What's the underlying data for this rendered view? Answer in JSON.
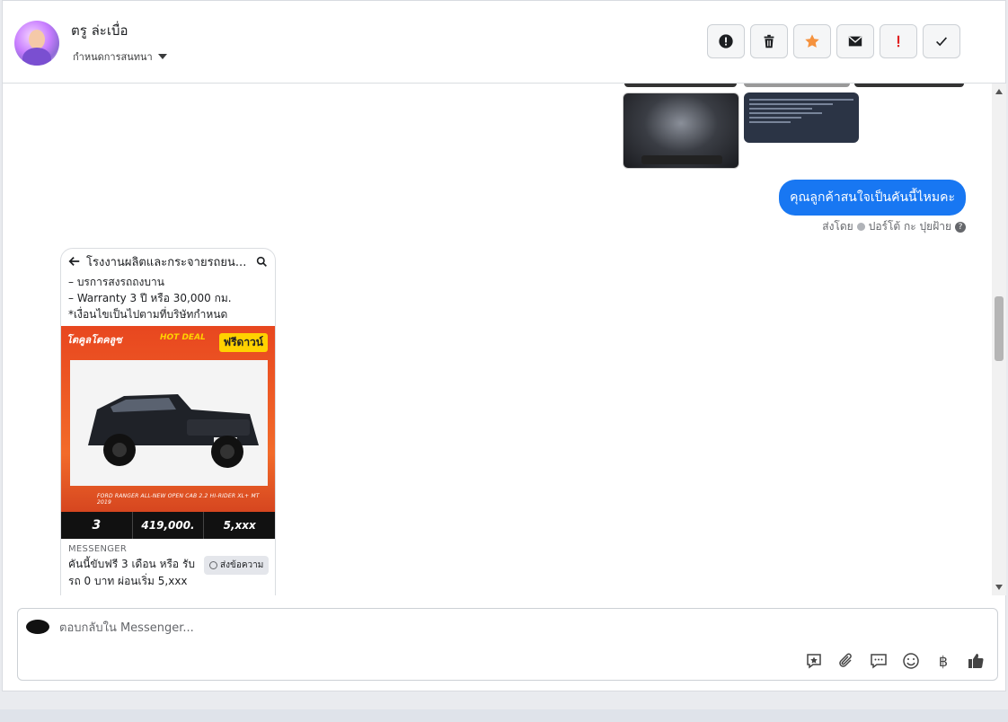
{
  "header": {
    "contact_name": "ตรู ล่ะเบื่อ",
    "assign_label": "กำหนดการสนทนา",
    "actions": [
      {
        "name": "report-button",
        "icon": "alert-circle-icon"
      },
      {
        "name": "delete-button",
        "icon": "trash-icon"
      },
      {
        "name": "star-button",
        "icon": "star-icon"
      },
      {
        "name": "mail-button",
        "icon": "envelope-icon"
      },
      {
        "name": "important-button",
        "icon": "exclamation-icon"
      },
      {
        "name": "done-button",
        "icon": "check-icon"
      }
    ]
  },
  "thread": {
    "outgoing_message": "คุณลูกค้าสนใจเป็นคันนี้ไหมคะ",
    "sent_by_label": "ส่งโดย",
    "sent_by_name": "ปอร์โต้ กะ ปุยฝ้าย",
    "card": {
      "title": "โรงงานผลิตและกระจายรถยน...",
      "lines": [
        "– บรการสงรถถงบาน",
        "– Warranty 3 ปี หรือ 30,000 กม.",
        "*เงื่อนไขเป็นไปตามที่บริษัทกำหนด"
      ],
      "poster": {
        "brand": "โตคูลโตคลูซ",
        "hot_deal": "HOT DEAL",
        "free_down": "ฟรีดาวน์",
        "model_text": "FORD RANGER ALL-NEW OPEN CAB 2.2 HI-RIDER XL+ MT 2019",
        "stat_1": "3",
        "price": "419,000.",
        "installment": "5,xxx"
      },
      "source": "MESSENGER",
      "description": "คันนี้ขับฟรี 3 เดือน หรือ รับรถ 0 บาท ผ่อนเริ่ม 5,xxx ...",
      "send_message_label": "ส่งข้อความ"
    }
  },
  "composer": {
    "placeholder": "ตอบกลับใน Messenger...",
    "value": "",
    "tools": [
      "saved-reply-icon",
      "paperclip-icon",
      "chat-bubbles-icon",
      "emoji-icon",
      "baht-icon",
      "thumbs-up-icon"
    ],
    "baht_symbol": "฿"
  },
  "colors": {
    "accent": "#1877f2",
    "star": "#f5923e",
    "important": "#e02020"
  }
}
